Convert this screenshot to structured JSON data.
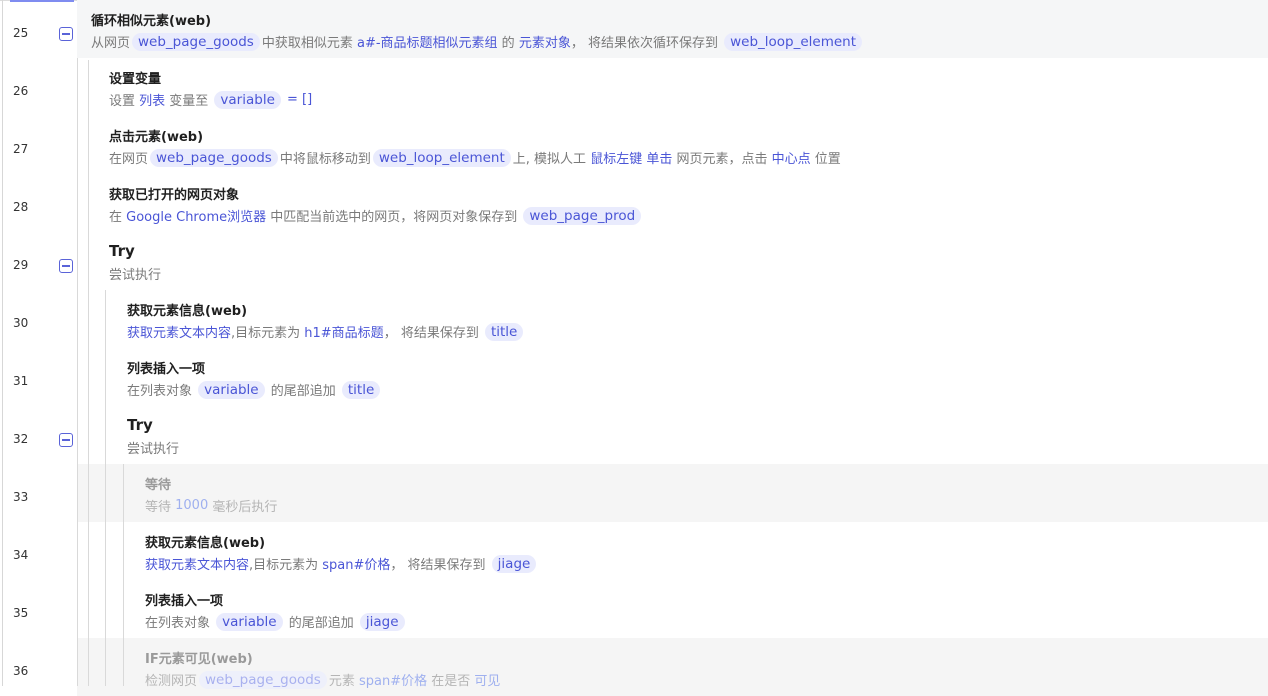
{
  "rows": [
    {
      "num": "25",
      "title": "循环相似元素(web)",
      "toggle": true,
      "big": false,
      "desc": [
        {
          "t": "text",
          "v": "从网页"
        },
        {
          "t": "var",
          "v": "web_page_goods"
        },
        {
          "t": "text",
          "v": "中获取相似元素 "
        },
        {
          "t": "kw",
          "v": "a#-商品标题相似元素组"
        },
        {
          "t": "text",
          "v": " 的 "
        },
        {
          "t": "kw",
          "v": "元素对象"
        },
        {
          "t": "text",
          "v": "， 将结果依次循环保存到 "
        },
        {
          "t": "var",
          "v": "web_loop_element"
        }
      ]
    },
    {
      "num": "26",
      "title": "设置变量",
      "toggle": false,
      "big": false,
      "desc": [
        {
          "t": "text",
          "v": "设置 "
        },
        {
          "t": "kw",
          "v": "列表"
        },
        {
          "t": "text",
          "v": " 变量至 "
        },
        {
          "t": "var",
          "v": "variable"
        },
        {
          "t": "kw",
          "v": " = []"
        }
      ]
    },
    {
      "num": "27",
      "title": "点击元素(web)",
      "toggle": false,
      "big": false,
      "desc": [
        {
          "t": "text",
          "v": "在网页"
        },
        {
          "t": "var",
          "v": "web_page_goods"
        },
        {
          "t": "text",
          "v": "中将鼠标移动到"
        },
        {
          "t": "var",
          "v": "web_loop_element"
        },
        {
          "t": "text",
          "v": "上, 模拟人工 "
        },
        {
          "t": "kw",
          "v": "鼠标左键 单击"
        },
        {
          "t": "text",
          "v": " 网页元素，点击 "
        },
        {
          "t": "kw",
          "v": "中心点"
        },
        {
          "t": "text",
          "v": " 位置"
        }
      ]
    },
    {
      "num": "28",
      "title": "获取已打开的网页对象",
      "toggle": false,
      "big": false,
      "desc": [
        {
          "t": "text",
          "v": "在 "
        },
        {
          "t": "kw",
          "v": "Google Chrome浏览器"
        },
        {
          "t": "text",
          "v": " 中匹配当前选中的网页，将网页对象保存到 "
        },
        {
          "t": "var",
          "v": "web_page_prod"
        }
      ]
    },
    {
      "num": "29",
      "title": "Try",
      "toggle": true,
      "big": true,
      "desc": [
        {
          "t": "text",
          "v": "尝试执行"
        }
      ]
    },
    {
      "num": "30",
      "title": "获取元素信息(web)",
      "toggle": false,
      "big": false,
      "desc": [
        {
          "t": "kw",
          "v": "获取元素文本内容"
        },
        {
          "t": "text",
          "v": ",目标元素为 "
        },
        {
          "t": "kw",
          "v": "h1#商品标题"
        },
        {
          "t": "text",
          "v": "， 将结果保存到 "
        },
        {
          "t": "var",
          "v": "title"
        }
      ]
    },
    {
      "num": "31",
      "title": "列表插入一项",
      "toggle": false,
      "big": false,
      "desc": [
        {
          "t": "text",
          "v": "在列表对象 "
        },
        {
          "t": "var",
          "v": "variable"
        },
        {
          "t": "text",
          "v": " 的尾部追加 "
        },
        {
          "t": "var",
          "v": "title"
        }
      ]
    },
    {
      "num": "32",
      "title": "Try",
      "toggle": true,
      "big": true,
      "desc": [
        {
          "t": "text",
          "v": "尝试执行"
        }
      ]
    },
    {
      "num": "33",
      "title": "等待",
      "toggle": false,
      "big": false,
      "disabled": true,
      "desc": [
        {
          "t": "text",
          "v": "等待 "
        },
        {
          "t": "kw",
          "v": "1000"
        },
        {
          "t": "text",
          "v": " 毫秒后执行"
        }
      ]
    },
    {
      "num": "34",
      "title": "获取元素信息(web)",
      "toggle": false,
      "big": false,
      "desc": [
        {
          "t": "kw",
          "v": "获取元素文本内容"
        },
        {
          "t": "text",
          "v": ",目标元素为 "
        },
        {
          "t": "kw",
          "v": "span#价格"
        },
        {
          "t": "text",
          "v": "， 将结果保存到 "
        },
        {
          "t": "var",
          "v": "jiage"
        }
      ]
    },
    {
      "num": "35",
      "title": "列表插入一项",
      "toggle": false,
      "big": false,
      "desc": [
        {
          "t": "text",
          "v": "在列表对象 "
        },
        {
          "t": "var",
          "v": "variable"
        },
        {
          "t": "text",
          "v": " 的尾部追加 "
        },
        {
          "t": "var",
          "v": "jiage"
        }
      ]
    },
    {
      "num": "36",
      "title": "IF元素可见(web)",
      "toggle": false,
      "big": false,
      "disabled": true,
      "desc": [
        {
          "t": "text",
          "v": "检测网页"
        },
        {
          "t": "var",
          "v": "web_page_goods"
        },
        {
          "t": "text",
          "v": "元素 "
        },
        {
          "t": "kw",
          "v": "span#价格"
        },
        {
          "t": "text",
          "v": " 在是否 "
        },
        {
          "t": "kw",
          "v": "可见"
        }
      ]
    }
  ]
}
